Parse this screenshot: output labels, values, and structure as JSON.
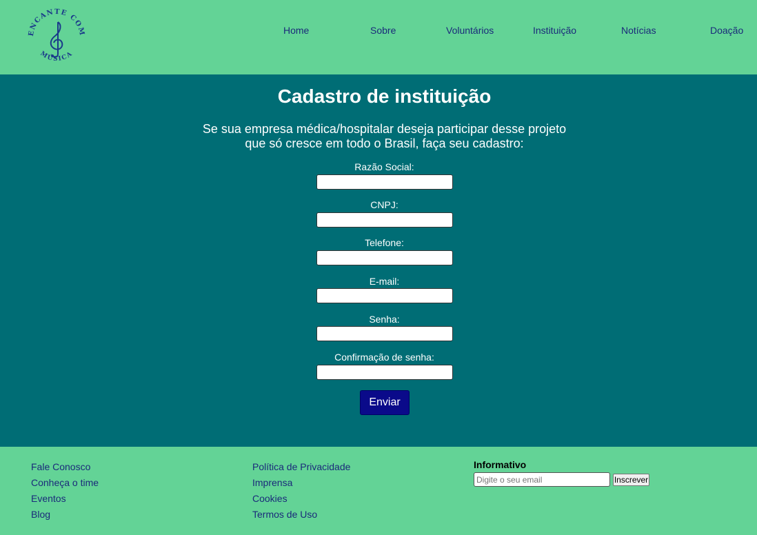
{
  "header": {
    "logo": {
      "top_text": "ENCANTE COM",
      "bottom_text": "MÚSICA",
      "icon": "treble-clef-icon",
      "color": "#1a3a8a"
    },
    "nav": [
      {
        "label": "Home"
      },
      {
        "label": "Sobre"
      },
      {
        "label": "Voluntários"
      },
      {
        "label": "Instituição"
      },
      {
        "label": "Notícias"
      },
      {
        "label": "Doação"
      }
    ]
  },
  "main": {
    "title": "Cadastro de instituição",
    "intro_line1": "Se sua empresa médica/hospitalar deseja participar desse projeto",
    "intro_line2": "que só cresce em todo o Brasil, faça seu cadastro:",
    "fields": [
      {
        "label": "Razão Social:",
        "value": ""
      },
      {
        "label": "CNPJ:",
        "value": ""
      },
      {
        "label": "Telefone:",
        "value": ""
      },
      {
        "label": "E-mail:",
        "value": ""
      },
      {
        "label": "Senha:",
        "value": ""
      },
      {
        "label": "Confirmação de senha:",
        "value": ""
      }
    ],
    "submit_label": "Enviar"
  },
  "footer": {
    "column1": [
      "Fale Conosco",
      "Conheça o time",
      "Eventos",
      "Blog"
    ],
    "column2": [
      "Política de Privacidade",
      "Imprensa",
      "Cookies",
      "Termos de Uso"
    ],
    "newsletter": {
      "title": "Informativo",
      "placeholder": "Digite o seu email",
      "button_label": "Inscrever"
    }
  },
  "colors": {
    "header_bg": "#63d396",
    "main_bg": "#006d75",
    "link_color": "#1a2a7a",
    "button_bg": "#0a0a8a"
  }
}
